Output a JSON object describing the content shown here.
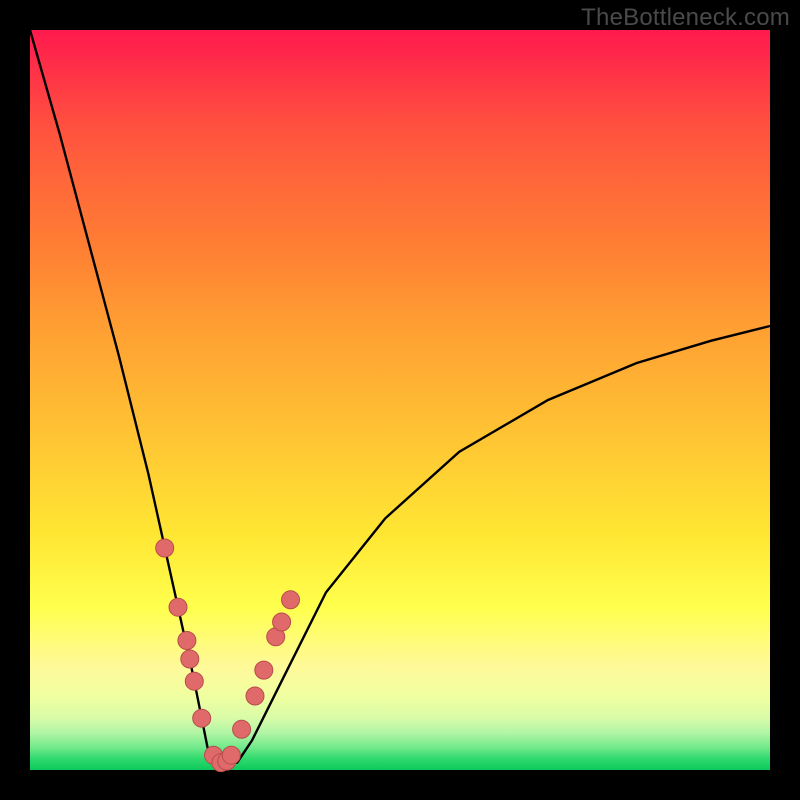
{
  "watermark": "TheBottleneck.com",
  "colors": {
    "frame": "#000000",
    "curve_stroke": "#000000",
    "marker_fill": "#e06a6a",
    "marker_stroke": "#b84c4c",
    "gradient_top": "#ff1a4d",
    "gradient_bottom": "#0cc95c"
  },
  "chart_data": {
    "type": "line",
    "title": "",
    "xlabel": "",
    "ylabel": "",
    "x_range": [
      0,
      1
    ],
    "y_range": [
      0,
      100
    ],
    "note": "Vertical axis reads as percent (0 bottom, 100 top). Horizontal axis is a normalised ratio 0–1. Curve dips to ~0% near x≈0.25 then climbs toward ~60% at x=1.",
    "series": [
      {
        "name": "bottleneck-curve",
        "x": [
          0.0,
          0.04,
          0.08,
          0.12,
          0.16,
          0.2,
          0.22,
          0.24,
          0.26,
          0.28,
          0.3,
          0.34,
          0.4,
          0.48,
          0.58,
          0.7,
          0.82,
          0.92,
          1.0
        ],
        "y": [
          100,
          86,
          71,
          56,
          40,
          22,
          13,
          3,
          1,
          1,
          4,
          12,
          24,
          34,
          43,
          50,
          55,
          58,
          60
        ]
      }
    ],
    "markers": {
      "name": "highlighted-points",
      "note": "Pink dots clustered around the trough region of the curve",
      "x": [
        0.182,
        0.2,
        0.212,
        0.216,
        0.222,
        0.232,
        0.248,
        0.258,
        0.266,
        0.272,
        0.286,
        0.304,
        0.316,
        0.332,
        0.34,
        0.352
      ],
      "y": [
        30.0,
        22.0,
        17.5,
        15.0,
        12.0,
        7.0,
        2.0,
        1.0,
        1.2,
        2.0,
        5.5,
        10.0,
        13.5,
        18.0,
        20.0,
        23.0
      ]
    }
  }
}
